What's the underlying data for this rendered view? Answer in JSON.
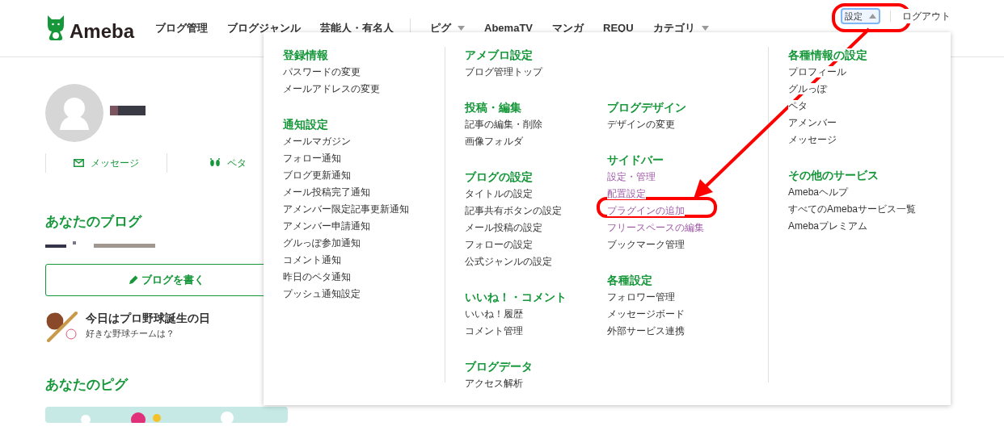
{
  "header": {
    "logo": "Ameba",
    "nav": [
      {
        "label": "ブログ管理",
        "dropdown": false
      },
      {
        "label": "ブログジャンル",
        "dropdown": false
      },
      {
        "label": "芸能人・有名人",
        "dropdown": false
      },
      {
        "label": "ピグ",
        "dropdown": true
      },
      {
        "label": "AbemaTV",
        "dropdown": false
      },
      {
        "label": "マンガ",
        "dropdown": false
      },
      {
        "label": "REQU",
        "dropdown": false
      },
      {
        "label": "カテゴリ",
        "dropdown": true
      }
    ],
    "settings_button": {
      "label": "設定",
      "expanded": true
    },
    "logout": "ログアウト"
  },
  "sidebar": {
    "actions": [
      {
        "label": "メッセージ",
        "kind": "mail"
      },
      {
        "label": "ペタ",
        "kind": "feet"
      }
    ],
    "blog_heading": "あなたのブログ",
    "write_button": "ブログを書く",
    "today": {
      "title": "今日はプロ野球誕生の日",
      "question": "好きな野球チームは？"
    },
    "pigg_heading": "あなたのピグ"
  },
  "menu": {
    "columns": [
      {
        "sections": [
          {
            "title": "登録情報",
            "items": [
              {
                "label": "パスワードの変更",
                "visited": false
              },
              {
                "label": "メールアドレスの変更",
                "visited": false
              }
            ]
          },
          {
            "title": "通知設定",
            "items": [
              {
                "label": "メールマガジン",
                "visited": false
              },
              {
                "label": "フォロー通知",
                "visited": false
              },
              {
                "label": "ブログ更新通知",
                "visited": false
              },
              {
                "label": "メール投稿完了通知",
                "visited": false
              },
              {
                "label": "アメンバー限定記事更新通知",
                "visited": false
              },
              {
                "label": "アメンバー申請通知",
                "visited": false
              },
              {
                "label": "グルっぽ参加通知",
                "visited": false
              },
              {
                "label": "コメント通知",
                "visited": false
              },
              {
                "label": "昨日のペタ通知",
                "visited": false
              },
              {
                "label": "プッシュ通知設定",
                "visited": false
              }
            ]
          }
        ]
      },
      {
        "sections": [
          {
            "title": "アメブロ設定",
            "items": [
              {
                "label": "ブログ管理トップ",
                "visited": false
              }
            ]
          }
        ],
        "subcolumns": [
          [
            {
              "title": "投稿・編集",
              "items": [
                {
                  "label": "記事の編集・削除",
                  "visited": false
                },
                {
                  "label": "画像フォルダ",
                  "visited": false
                }
              ]
            },
            {
              "title": "ブログの設定",
              "items": [
                {
                  "label": "タイトルの設定",
                  "visited": false
                },
                {
                  "label": "記事共有ボタンの設定",
                  "visited": false
                },
                {
                  "label": "メール投稿の設定",
                  "visited": false
                },
                {
                  "label": "フォローの設定",
                  "visited": false
                },
                {
                  "label": "公式ジャンルの設定",
                  "visited": false
                }
              ]
            },
            {
              "title": "いいね！・コメント",
              "items": [
                {
                  "label": "いいね！履歴",
                  "visited": false
                },
                {
                  "label": "コメント管理",
                  "visited": false
                }
              ]
            },
            {
              "title": "ブログデータ",
              "items": [
                {
                  "label": "アクセス解析",
                  "visited": false
                }
              ]
            }
          ],
          [
            {
              "title": "ブログデザイン",
              "items": [
                {
                  "label": "デザインの変更",
                  "visited": false
                }
              ]
            },
            {
              "title": "サイドバー",
              "items": [
                {
                  "label": "設定・管理",
                  "visited": true
                },
                {
                  "label": "配置設定",
                  "visited": true
                },
                {
                  "label": "プラグインの追加",
                  "visited": true
                },
                {
                  "label": "フリースペースの編集",
                  "visited": true
                },
                {
                  "label": "ブックマーク管理",
                  "visited": false
                }
              ]
            },
            {
              "title": "各種設定",
              "items": [
                {
                  "label": "フォロワー管理",
                  "visited": false
                },
                {
                  "label": "メッセージボード",
                  "visited": false
                },
                {
                  "label": "外部サービス連携",
                  "visited": false
                }
              ]
            }
          ]
        ]
      },
      {
        "sections": [
          {
            "title": "各種情報の設定",
            "items": [
              {
                "label": "プロフィール",
                "visited": false
              },
              {
                "label": "グルっぽ",
                "visited": false
              },
              {
                "label": "ペタ",
                "visited": false
              },
              {
                "label": "アメンバー",
                "visited": false
              },
              {
                "label": "メッセージ",
                "visited": false
              }
            ]
          },
          {
            "title": "その他のサービス",
            "items": [
              {
                "label": "Amebaヘルプ",
                "visited": false
              },
              {
                "label": "すべてのAmebaサービス一覧",
                "visited": false
              },
              {
                "label": "Amebaプレミアム",
                "visited": false
              }
            ]
          }
        ]
      }
    ]
  }
}
